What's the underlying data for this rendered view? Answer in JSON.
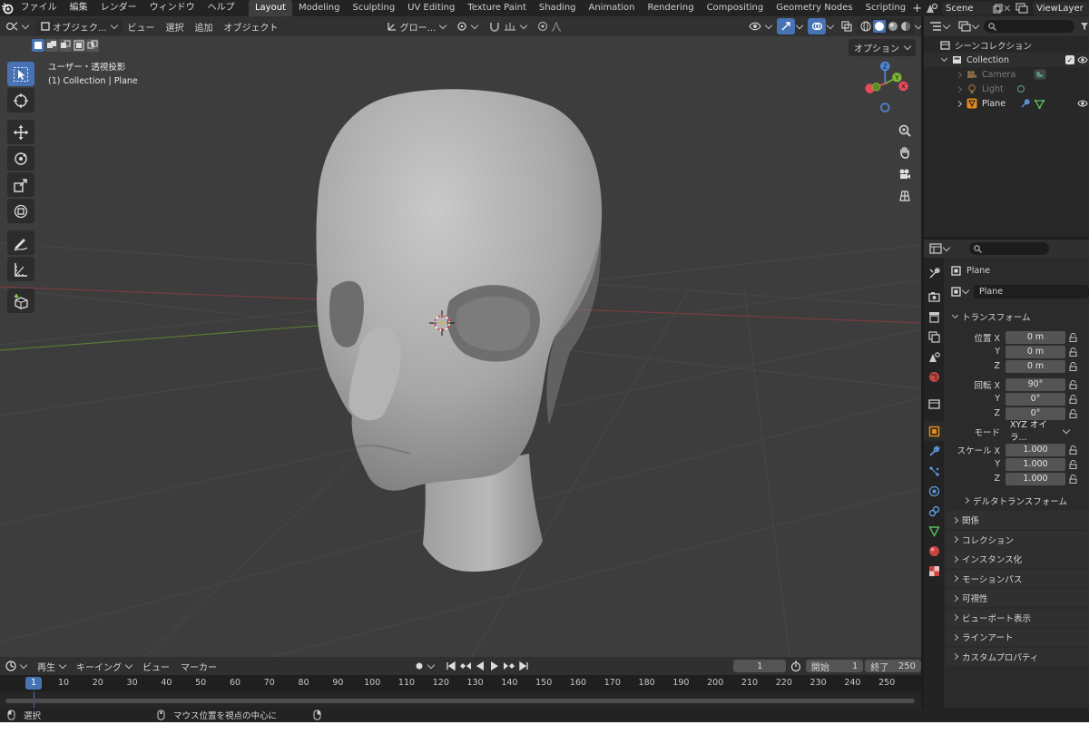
{
  "menu": [
    "ファイル",
    "編集",
    "レンダー",
    "ウィンドウ",
    "ヘルプ"
  ],
  "workspaces": [
    "Layout",
    "Modeling",
    "Sculpting",
    "UV Editing",
    "Texture Paint",
    "Shading",
    "Animation",
    "Rendering",
    "Compositing",
    "Geometry Nodes",
    "Scripting"
  ],
  "active_workspace": "Layout",
  "scene_name": "Scene",
  "view_layer": "ViewLayer",
  "viewport": {
    "mode": "オブジェク...",
    "menus": [
      "ビュー",
      "選択",
      "追加",
      "オブジェクト"
    ],
    "transform_orientation": "グロー...",
    "options_label": "オプション",
    "info_line1": "ユーザー・透視投影",
    "info_line2": "(1) Collection | Plane"
  },
  "outliner": {
    "root": "シーンコレクション",
    "collection": "Collection",
    "items": [
      {
        "name": "Camera",
        "dim": true
      },
      {
        "name": "Light",
        "dim": true
      },
      {
        "name": "Plane",
        "dim": false
      }
    ]
  },
  "properties": {
    "object_name": "Plane",
    "data_name": "Plane",
    "transform_title": "トランスフォーム",
    "location": {
      "label_x": "位置 X",
      "label_y": "Y",
      "label_z": "Z",
      "x": "0 m",
      "y": "0 m",
      "z": "0 m"
    },
    "rotation": {
      "label_x": "回転 X",
      "label_y": "Y",
      "label_z": "Z",
      "x": "90°",
      "y": "0°",
      "z": "0°"
    },
    "mode_label": "モード",
    "mode_value": "XYZ オイラ...",
    "scale": {
      "label_x": "スケール X",
      "label_y": "Y",
      "label_z": "Z",
      "x": "1.000",
      "y": "1.000",
      "z": "1.000"
    },
    "delta_transform": "デルタトランスフォーム",
    "panels": [
      "関係",
      "コレクション",
      "インスタンス化",
      "モーションパス",
      "可視性",
      "ビューポート表示",
      "ラインアート",
      "カスタムプロパティ"
    ]
  },
  "timeline": {
    "menus": [
      "再生",
      "キーイング",
      "ビュー",
      "マーカー"
    ],
    "current_frame": "1",
    "start_label": "開始",
    "start": "1",
    "end_label": "終了",
    "end": "250",
    "ruler": [
      "1",
      "10",
      "20",
      "30",
      "40",
      "50",
      "60",
      "70",
      "80",
      "90",
      "100",
      "110",
      "120",
      "130",
      "140",
      "150",
      "160",
      "170",
      "180",
      "190",
      "200",
      "210",
      "220",
      "230",
      "240",
      "250"
    ]
  },
  "status": {
    "select": "選択",
    "center_view": "マウス位置を視点の中心に"
  },
  "colors": {
    "accent": "#4772b3",
    "viewport_bg": "#3d3d3d",
    "axis_x": "#e9495a",
    "axis_y": "#7db431",
    "axis_z": "#4d87d6"
  }
}
